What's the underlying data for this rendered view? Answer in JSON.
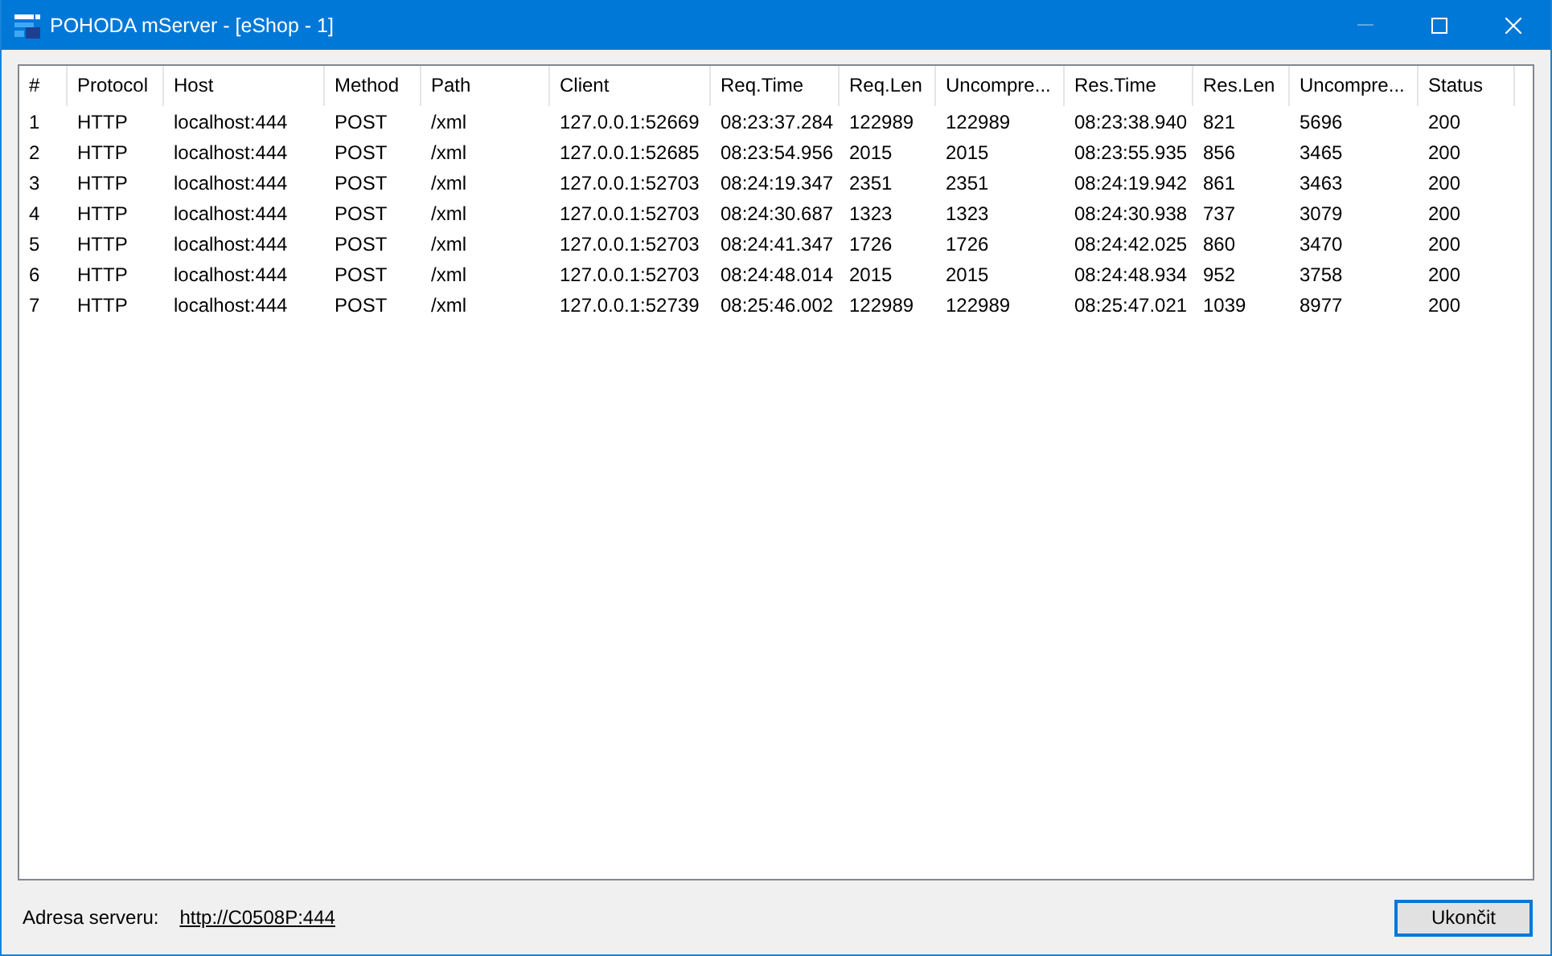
{
  "window": {
    "title": "POHODA mServer - [eShop - 1]",
    "controls": [
      {
        "kind": "minimize",
        "disabled": true
      },
      {
        "kind": "maximize",
        "disabled": false
      },
      {
        "kind": "close",
        "disabled": false
      }
    ]
  },
  "table": {
    "columns": [
      "#",
      "Protocol",
      "Host",
      "Method",
      "Path",
      "Client",
      "Req.Time",
      "Req.Len",
      "Uncompre...",
      "Res.Time",
      "Res.Len",
      "Uncompre...",
      "Status"
    ],
    "rows": [
      [
        "1",
        "HTTP",
        "localhost:444",
        "POST",
        "/xml",
        "127.0.0.1:52669",
        "08:23:37.284",
        "122989",
        "122989",
        "08:23:38.940",
        "821",
        "5696",
        "200"
      ],
      [
        "2",
        "HTTP",
        "localhost:444",
        "POST",
        "/xml",
        "127.0.0.1:52685",
        "08:23:54.956",
        "2015",
        "2015",
        "08:23:55.935",
        "856",
        "3465",
        "200"
      ],
      [
        "3",
        "HTTP",
        "localhost:444",
        "POST",
        "/xml",
        "127.0.0.1:52703",
        "08:24:19.347",
        "2351",
        "2351",
        "08:24:19.942",
        "861",
        "3463",
        "200"
      ],
      [
        "4",
        "HTTP",
        "localhost:444",
        "POST",
        "/xml",
        "127.0.0.1:52703",
        "08:24:30.687",
        "1323",
        "1323",
        "08:24:30.938",
        "737",
        "3079",
        "200"
      ],
      [
        "5",
        "HTTP",
        "localhost:444",
        "POST",
        "/xml",
        "127.0.0.1:52703",
        "08:24:41.347",
        "1726",
        "1726",
        "08:24:42.025",
        "860",
        "3470",
        "200"
      ],
      [
        "6",
        "HTTP",
        "localhost:444",
        "POST",
        "/xml",
        "127.0.0.1:52703",
        "08:24:48.014",
        "2015",
        "2015",
        "08:24:48.934",
        "952",
        "3758",
        "200"
      ],
      [
        "7",
        "HTTP",
        "localhost:444",
        "POST",
        "/xml",
        "127.0.0.1:52739",
        "08:25:46.002",
        "122989",
        "122989",
        "08:25:47.021",
        "1039",
        "8977",
        "200"
      ]
    ]
  },
  "footer": {
    "label": "Adresa serveru:",
    "link": "http://C0508P:444",
    "button": {
      "label": "Ukončit",
      "focused": true
    }
  }
}
